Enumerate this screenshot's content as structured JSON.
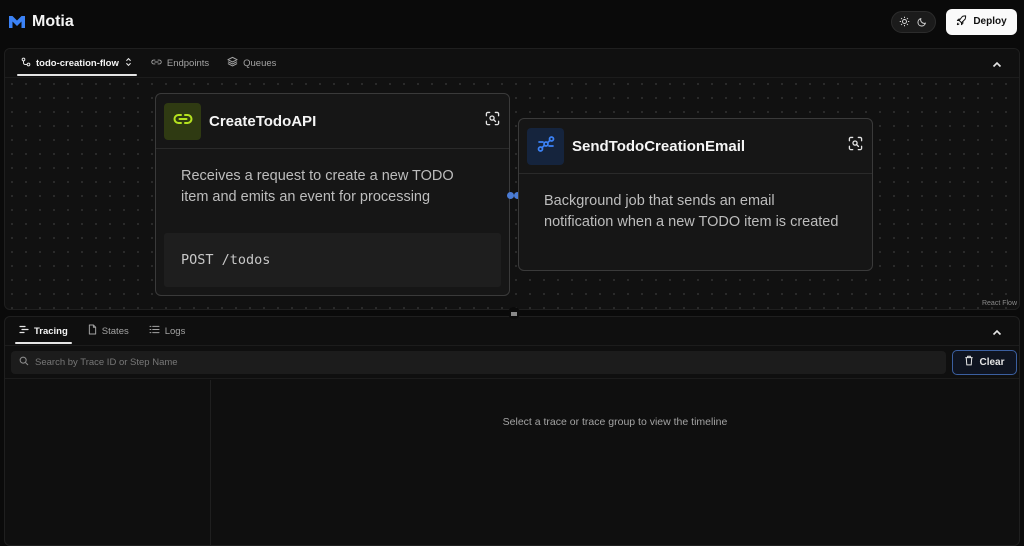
{
  "app": {
    "name": "Motia",
    "brand_color": "#3b82f6"
  },
  "header": {
    "deploy_label": "Deploy",
    "theme_icons": [
      "sun-icon",
      "moon-icon"
    ]
  },
  "flow_panel": {
    "tabs": [
      {
        "label": "todo-creation-flow",
        "icon": "flow-icon",
        "active": true,
        "has_dropdown": true
      },
      {
        "label": "Endpoints",
        "icon": "link-icon",
        "active": false
      },
      {
        "label": "Queues",
        "icon": "layers-icon",
        "active": false
      }
    ],
    "attribution": "React Flow"
  },
  "nodes": [
    {
      "title": "CreateTodoAPI",
      "icon": "link-icon",
      "icon_bg": "#2f3a12",
      "icon_color": "#b5e21f",
      "description": "Receives a request to create a new TODO item and emits an event for processing",
      "code": "POST /todos"
    },
    {
      "title": "SendTodoCreationEmail",
      "icon": "event-icon",
      "icon_bg": "#15243d",
      "icon_color": "#3b82f6",
      "description": "Background job that sends an email notification when a new TODO item is created"
    }
  ],
  "bottom_panel": {
    "tabs": [
      {
        "label": "Tracing",
        "icon": "tracing-icon",
        "active": true
      },
      {
        "label": "States",
        "icon": "file-icon",
        "active": false
      },
      {
        "label": "Logs",
        "icon": "list-icon",
        "active": false
      }
    ],
    "search_placeholder": "Search by Trace ID or Step Name",
    "clear_label": "Clear",
    "empty_message": "Select a trace or trace group to view the timeline"
  }
}
